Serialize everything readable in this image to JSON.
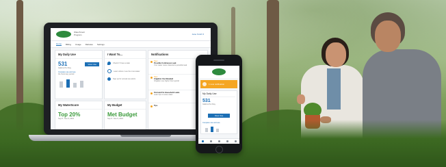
{
  "laptop": {
    "logo_sub": "WaterSmart Program",
    "account_link": "Jane Smith ▾",
    "nav": [
      "Home",
      "Billing",
      "Usage",
      "Rebates",
      "Settings"
    ],
    "daily_use": {
      "title": "My Daily Use",
      "value": "531",
      "unit": "Gallons Per Day",
      "button": "View Use",
      "compare": "Compare use and see",
      "compare2": "the Summary period"
    },
    "i_want_to": {
      "title": "I Want To...",
      "items": [
        "Check if I have a leak",
        "Learn where I use the most water",
        "Sign up for annual use alerts"
      ]
    },
    "notifications": {
      "title": "Notifications",
      "items": [
        {
          "tag": "New",
          "title": "Possible Continuous Leak",
          "text": "Your water meter detected a possible leak"
        },
        {
          "tag": "New",
          "title": "Irrigation Use Elevated",
          "text": "Irrigation use higher than typical"
        },
        {
          "tag": "",
          "title": "Find and Fix Household Leaks",
          "text": "Learn tips to save water"
        },
        {
          "tag": "",
          "title": "Tips",
          "text": ""
        }
      ]
    },
    "waterscore": {
      "title": "My WaterScore",
      "value": "Top 20%",
      "sub": "Sep 8 - Nov 9, 2016"
    },
    "budget": {
      "title": "My Budget",
      "value": "Met Budget",
      "sub": "Sep 8 - Nov 9, 2016"
    }
  },
  "phone": {
    "alert": "1 new notification",
    "card_title": "My Daily Use",
    "value": "531",
    "unit": "Gallons Per Day",
    "button": "View Use",
    "compare": "Compare use and see"
  },
  "colors": {
    "accent": "#1c6fb5",
    "alert": "#f5a623",
    "brand_green": "#2e8a3e",
    "score_green": "#3b9a3b"
  }
}
